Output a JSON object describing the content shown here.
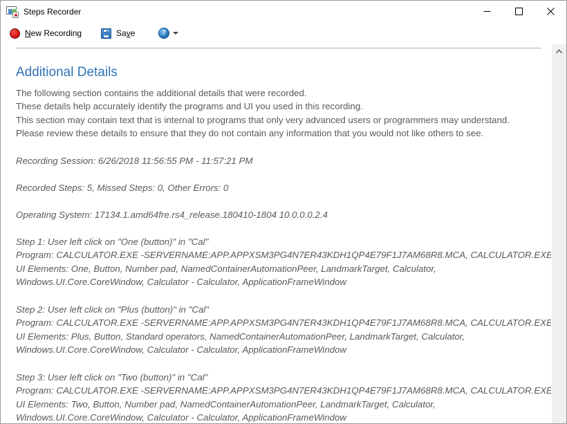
{
  "window": {
    "title": "Steps Recorder",
    "app_icon": "steps-recorder-icon",
    "controls": {
      "minimize": "minimize-icon",
      "maximize": "maximize-icon",
      "close": "close-icon"
    }
  },
  "toolbar": {
    "new_recording": {
      "label_prefix": "",
      "accesskey": "N",
      "label_rest": "ew Recording",
      "full_label": "New Recording",
      "icon": "record-icon"
    },
    "save": {
      "label_before": "Sa",
      "accesskey": "v",
      "label_after": "e",
      "full_label": "Save",
      "icon": "floppy-disk-icon"
    },
    "help": {
      "icon": "help-icon",
      "dropdown_icon": "chevron-down-icon"
    }
  },
  "document": {
    "section_title": "Additional Details",
    "intro_lines": [
      "The following section contains the additional details that were recorded.",
      "These details help accurately identify the programs and UI you used in this recording.",
      "This section may contain text that is internal to programs that only very advanced users or programmers may understand.",
      "Please review these details to ensure that they do not contain any information that you would not like others to see."
    ],
    "meta": [
      "Recording Session: 6/26/2018 11:56:55 PM - 11:57:21 PM",
      "Recorded Steps: 5, Missed Steps: 0, Other Errors: 0",
      "Operating System: 17134.1.amd64fre.rs4_release.180410-1804 10.0.0.0.2.4"
    ],
    "steps": [
      {
        "header": "Step 1: User left click on \"One (button)\" in \"Cal\"",
        "program": "Program: CALCULATOR.EXE -SERVERNAME:APP.APPXSM3PG4N7ER43KDH1QP4E79F1J7AM68R8.MCA, CALCULATOR.EXE",
        "ui_elements_line1": "UI Elements: One, Button, Number pad, NamedContainerAutomationPeer, LandmarkTarget, Calculator,",
        "ui_elements_line2": "Windows.UI.Core.CoreWindow, Calculator - Calculator, ApplicationFrameWindow"
      },
      {
        "header": "Step 2: User left click on \"Plus (button)\" in \"Cal\"",
        "program": "Program: CALCULATOR.EXE -SERVERNAME:APP.APPXSM3PG4N7ER43KDH1QP4E79F1J7AM68R8.MCA, CALCULATOR.EXE",
        "ui_elements_line1": "UI Elements: Plus, Button, Standard operators, NamedContainerAutomationPeer, LandmarkTarget, Calculator,",
        "ui_elements_line2": "Windows.UI.Core.CoreWindow, Calculator - Calculator, ApplicationFrameWindow"
      },
      {
        "header": "Step 3: User left click on \"Two (button)\" in \"Cal\"",
        "program": "Program: CALCULATOR.EXE -SERVERNAME:APP.APPXSM3PG4N7ER43KDH1QP4E79F1J7AM68R8.MCA, CALCULATOR.EXE",
        "ui_elements_line1": "UI Elements: Two, Button, Number pad, NamedContainerAutomationPeer, LandmarkTarget, Calculator,",
        "ui_elements_line2": "Windows.UI.Core.CoreWindow, Calculator - Calculator, ApplicationFrameWindow"
      }
    ]
  },
  "scrollbar": {
    "up_icon": "chevron-up-icon",
    "down_icon": "chevron-down-icon"
  },
  "colors": {
    "heading": "#2e74b5",
    "body_text": "#595959",
    "record_red": "#d91818",
    "accent_blue": "#2f7fc4",
    "divider": "#a9b0bd",
    "scrollbar_track": "#f0f0f0"
  }
}
